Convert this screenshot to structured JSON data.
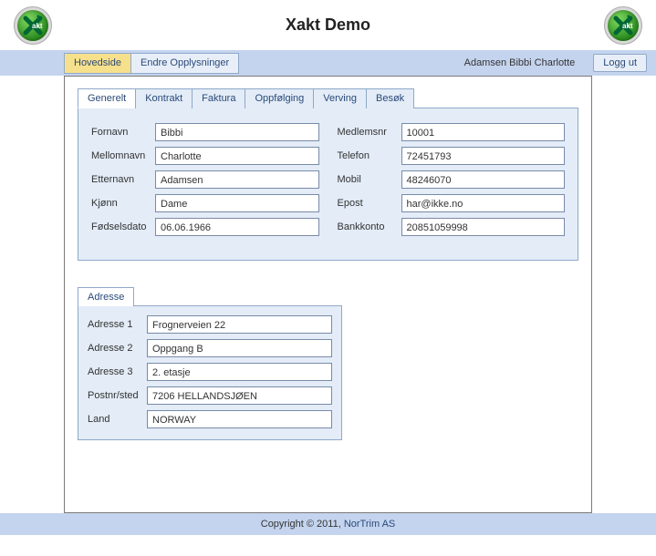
{
  "header": {
    "title": "Xakt Demo",
    "logo_text": "akt"
  },
  "menu": {
    "hovedside": "Hovedside",
    "endre": "Endre Opplysninger",
    "user": "Adamsen Bibbi Charlotte",
    "logout": "Logg ut"
  },
  "tabs": {
    "generelt": "Generelt",
    "kontrakt": "Kontrakt",
    "faktura": "Faktura",
    "oppfolging": "Oppfølging",
    "verving": "Verving",
    "besok": "Besøk"
  },
  "labels": {
    "fornavn": "Fornavn",
    "mellomnavn": "Mellomnavn",
    "etternavn": "Etternavn",
    "kjonn": "Kjønn",
    "fodselsdato": "Fødselsdato",
    "medlemsnr": "Medlemsnr",
    "telefon": "Telefon",
    "mobil": "Mobil",
    "epost": "Epost",
    "bankkonto": "Bankkonto",
    "adresse_tab": "Adresse",
    "adresse1": "Adresse 1",
    "adresse2": "Adresse 2",
    "adresse3": "Adresse 3",
    "postnr": "Postnr/sted",
    "land": "Land"
  },
  "values": {
    "fornavn": "Bibbi",
    "mellomnavn": "Charlotte",
    "etternavn": "Adamsen",
    "kjonn": "Dame",
    "fodselsdato": "06.06.1966",
    "medlemsnr": "10001",
    "telefon": "72451793",
    "mobil": "48246070",
    "epost": "har@ikke.no",
    "bankkonto": "20851059998",
    "adresse1": "Frognerveien 22",
    "adresse2": "Oppgang B",
    "adresse3": "2. etasje",
    "postnr": "7206 HELLANDSJØEN",
    "land": "NORWAY"
  },
  "footer": {
    "copyright": "Copyright © 2011, ",
    "link": "NorTrim AS"
  }
}
